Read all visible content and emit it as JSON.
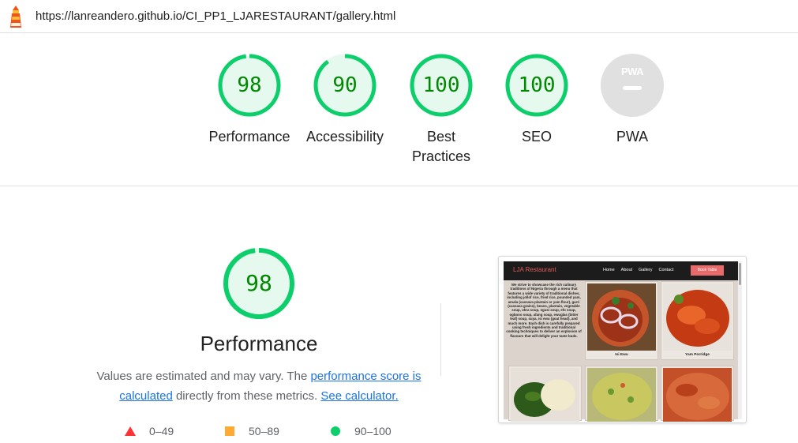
{
  "browser": {
    "url": "https://lanreandero.github.io/CI_PP1_LJARESTAURANT/gallery.html",
    "logo_icon": "lighthouse-icon"
  },
  "categories": [
    {
      "score": "98",
      "label": "Performance",
      "value": 98,
      "color": "#0cce6b"
    },
    {
      "score": "90",
      "label": "Accessibility",
      "value": 90,
      "color": "#0cce6b"
    },
    {
      "score": "100",
      "label": "Best Practices",
      "value": 100,
      "color": "#0cce6b"
    },
    {
      "score": "100",
      "label": "SEO",
      "value": 100,
      "color": "#0cce6b"
    },
    {
      "score": "PWA",
      "label": "PWA",
      "value": null,
      "color": "#e0e0e0"
    }
  ],
  "performance": {
    "score": "98",
    "value": 98,
    "title": "Performance",
    "desc_prefix": "Values are estimated and may vary. The ",
    "desc_link1": "performance score is calculated",
    "desc_middle": " directly from these metrics. ",
    "desc_link2": "See calculator."
  },
  "legend": [
    {
      "range": "0–49",
      "shape": "triangle-icon",
      "color": "#ff3333"
    },
    {
      "range": "50–89",
      "shape": "square-icon",
      "color": "#ffaa33"
    },
    {
      "range": "90–100",
      "shape": "circle-icon",
      "color": "#0cce6b"
    }
  ],
  "thumbnail": {
    "brand": "LJA Restaurant",
    "nav": [
      "Home",
      "About",
      "Gallery",
      "Contact"
    ],
    "cta": "Book Table",
    "intro": "We strive to showcase the rich culinary traditions of Nigeria through a menu that features a wide variety of traditional dishes, including jollof rice, fried rice, pounded yam, amala (cassava plantain or yam flour), garri (cassava grains), beans, plantain, vegetable soup, okra soup, egusi soup, efo soup, ogbono soup, afang soup, ewuglas (bitter leaf) soup, suya, isi ewu (goat head), and much more. Each dish is carefully prepared using fresh ingredients and traditional cooking techniques to deliver an explosion of flavours that will delight your taste buds.",
    "captions": [
      "Isi Ewu",
      "Yam Porridge"
    ]
  }
}
